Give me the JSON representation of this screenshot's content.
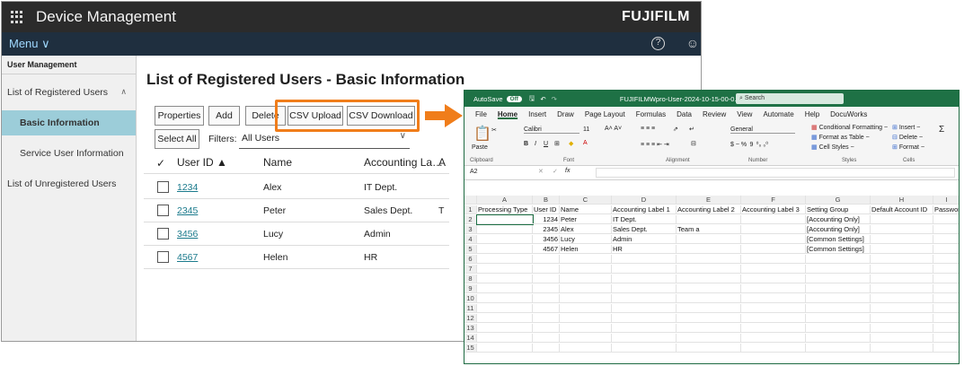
{
  "device_app": {
    "title": "Device Management",
    "brand": "FUJIFILM",
    "menu_label": "Menu ∨",
    "sidebar": {
      "header": "User Management",
      "registered": "List of Registered Users",
      "basic": "Basic Information",
      "service": "Service User Information",
      "unregistered": "List of Unregistered Users"
    },
    "page_title": "List of Registered Users - Basic Information",
    "buttons": {
      "properties": "Properties",
      "add": "Add",
      "delete": "Delete",
      "csv_upload": "CSV Upload",
      "csv_download": "CSV Download",
      "select_all": "Select All"
    },
    "filter_label": "Filters:",
    "filter_value": "All Users",
    "columns": {
      "user_id": "User ID ▲",
      "name": "Name",
      "accounting": "Accounting La…",
      "extra": "A"
    },
    "rows": [
      {
        "id": "1234",
        "name": "Alex",
        "dept": "IT Dept.",
        "extra": ""
      },
      {
        "id": "2345",
        "name": "Peter",
        "dept": "Sales Dept.",
        "extra": "T"
      },
      {
        "id": "3456",
        "name": "Lucy",
        "dept": "Admin",
        "extra": ""
      },
      {
        "id": "4567",
        "name": "Helen",
        "dept": "HR",
        "extra": ""
      }
    ]
  },
  "excel": {
    "autosave": "AutoSave",
    "toggle": "Off",
    "filename": "FUJIFILMWpro-User-2024-10-15-00-0...",
    "search": "Search",
    "tabs": [
      "File",
      "Home",
      "Insert",
      "Draw",
      "Page Layout",
      "Formulas",
      "Data",
      "Review",
      "View",
      "Automate",
      "Help",
      "DocuWorks"
    ],
    "ribbon": {
      "paste": "Paste",
      "font": "Calibri",
      "size": "11",
      "number_format": "General",
      "conditional": "Conditional Formatting ~",
      "format_table": "Format as Table ~",
      "cell_styles": "Cell Styles ~",
      "insert": "Insert ~",
      "delete": "Delete ~",
      "format": "Format ~",
      "groups": [
        "Clipboard",
        "Font",
        "Alignment",
        "Number",
        "Styles",
        "Cells"
      ]
    },
    "name_box": "A2",
    "fx": "fx",
    "col_letters": [
      "A",
      "B",
      "C",
      "D",
      "E",
      "F",
      "G",
      "H",
      "I"
    ],
    "header_row": [
      "Processing Type",
      "User ID",
      "Name",
      "Accounting Label 1",
      "Accounting Label 2",
      "Accounting Label 3",
      "Setting Group",
      "Default Account ID",
      "Password"
    ],
    "data_rows": [
      [
        "",
        "1234",
        "Peter",
        "IT Dept.",
        "",
        "",
        "[Accounting Only]",
        "",
        ""
      ],
      [
        "",
        "2345",
        "Alex",
        "Sales Dept.",
        "Team a",
        "",
        "[Accounting Only]",
        "",
        ""
      ],
      [
        "",
        "3456",
        "Lucy",
        "Admin",
        "",
        "",
        "[Common Settings]",
        "",
        ""
      ],
      [
        "",
        "4567",
        "Helen",
        "HR",
        "",
        "",
        "[Common Settings]",
        "",
        ""
      ]
    ],
    "row_numbers": [
      "1",
      "2",
      "3",
      "4",
      "5",
      "6",
      "7",
      "8",
      "9",
      "10",
      "11",
      "12",
      "13",
      "14",
      "15"
    ],
    "accent": "#1e7145"
  },
  "highlight_color": "#f07d1a"
}
